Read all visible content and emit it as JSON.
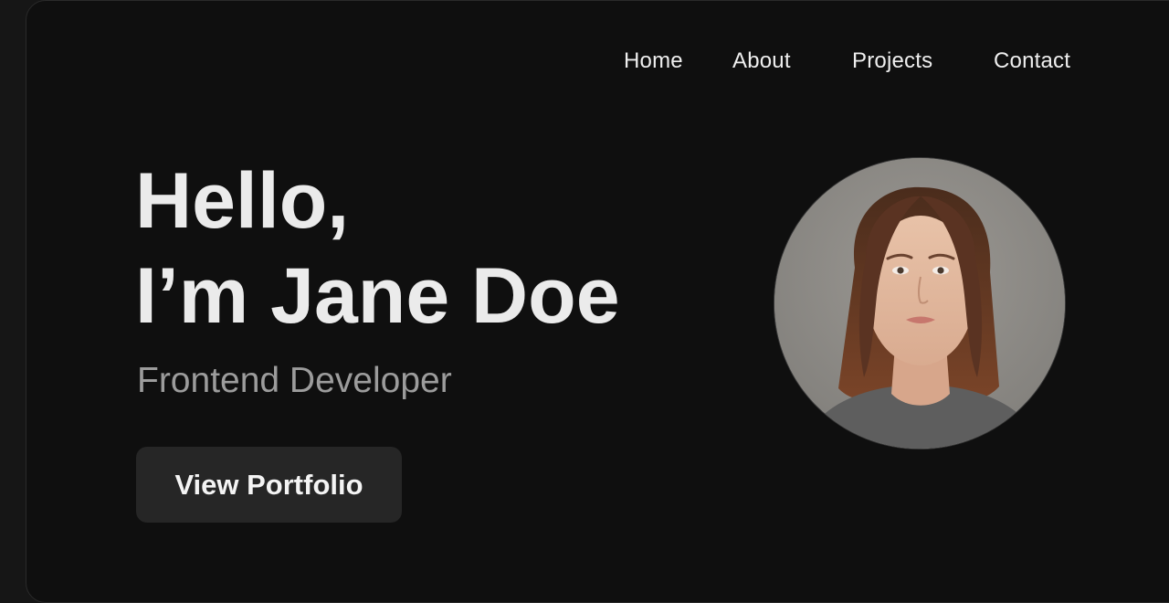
{
  "nav": {
    "items": [
      {
        "label": "Home"
      },
      {
        "label": "About"
      },
      {
        "label": "Projects"
      },
      {
        "label": "Contact"
      }
    ]
  },
  "hero": {
    "title_line1": "Hello,",
    "title_line2": "I’m Jane Doe",
    "subtitle": "Frontend Developer",
    "cta_label": "View Portfolio"
  },
  "avatar": {
    "icon": "portrait-photo",
    "alt": "Jane Doe"
  },
  "colors": {
    "background": "#0f0f0f",
    "title": "#ebebeb",
    "subtitle": "#9c9c9c",
    "button_bg": "#262626",
    "nav_text": "#efefef"
  }
}
